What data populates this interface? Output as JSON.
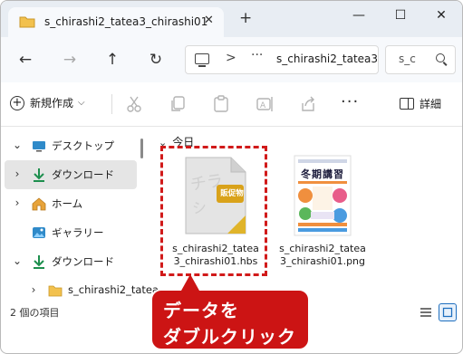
{
  "window": {
    "tab_title": "s_chirashi2_tatea3_chirashi01",
    "tab_close": "✕",
    "new_tab": "+",
    "minimize": "—",
    "maximize": "☐",
    "close": "✕"
  },
  "nav": {
    "back": "←",
    "forward": "→",
    "up": "↑",
    "refresh": "↻",
    "breadcrumb_sep": ">",
    "breadcrumb_more": "···",
    "breadcrumb_current": "s_chirashi2_tatea3",
    "search_placeholder": "s_c"
  },
  "commandbar": {
    "new_label": "新規作成",
    "new_chevron": "⌵",
    "more": "···",
    "details_label": "詳細"
  },
  "sidebar": {
    "items": [
      {
        "label": "デスクトップ",
        "chevron": "⌄",
        "icon": "desktop-icon"
      },
      {
        "label": "ダウンロード",
        "chevron": "›",
        "icon": "download-icon"
      },
      {
        "label": "ホーム",
        "chevron": "›",
        "icon": "home-icon"
      },
      {
        "label": "ギャラリー",
        "chevron": "",
        "icon": "gallery-icon"
      },
      {
        "label": "ダウンロード",
        "chevron": "⌄",
        "icon": "download-icon"
      },
      {
        "label": "s_chirashi2_tatea",
        "chevron": "›",
        "icon": "folder-icon"
      }
    ]
  },
  "content": {
    "group_label": "今日",
    "group_chevron": "⌄",
    "files": [
      {
        "name_line1": "s_chirashi2_tatea",
        "name_line2": "3_chirashi01.hbs",
        "icon": "hbs-file-icon"
      },
      {
        "name_line1": "s_chirashi2_tatea",
        "name_line2": "3_chirashi01.png",
        "icon": "png-thumbnail-icon"
      }
    ],
    "hbs_badge": "販促物",
    "poster_title": "冬期講習"
  },
  "status": {
    "item_count": "2 個の項目"
  },
  "callout": {
    "line1": "データを",
    "line2": "ダブルクリック"
  },
  "colors": {
    "accent": "#1f6fbf",
    "callout": "#cc1414",
    "highlight": "#d11a1a",
    "download_green": "#1e8f4e",
    "folder_yellow": "#f2c14e"
  }
}
